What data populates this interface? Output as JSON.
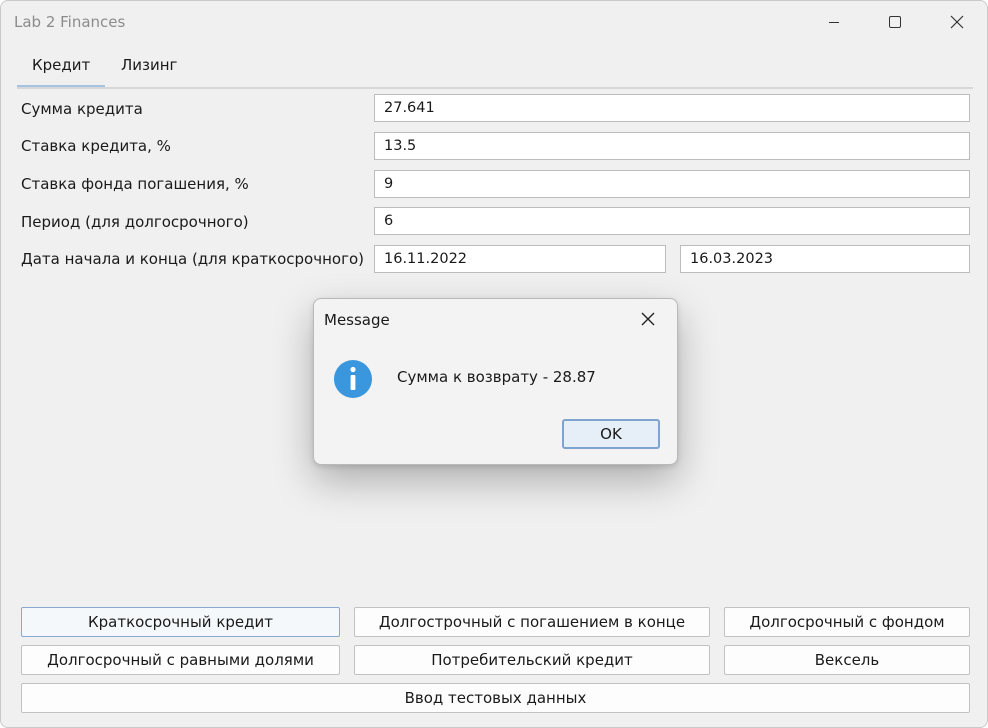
{
  "window": {
    "title": "Lab 2 Finances"
  },
  "tabs": [
    {
      "label": "Кредит",
      "active": true
    },
    {
      "label": "Лизинг",
      "active": false
    }
  ],
  "form": {
    "loan_amount": {
      "label": "Сумма кредита",
      "value": "27.641"
    },
    "loan_rate": {
      "label": "Ставка кредита, %",
      "value": "13.5"
    },
    "fund_rate": {
      "label": "Ставка фонда погашения, %",
      "value": "9"
    },
    "period": {
      "label": "Период (для долгосрочного)",
      "value": "6"
    },
    "dates": {
      "label": "Дата начала и конца (для краткосрочного)",
      "start": "16.11.2022",
      "end": "16.03.2023"
    }
  },
  "buttons": {
    "short_term": "Краткосрочный кредит",
    "long_term_end": "Долгострочный с погашением в конце",
    "long_term_fund": "Долгосрочный с фондом",
    "long_term_equal": "Долгосрочный с равными долями",
    "consumer": "Потребительский кредит",
    "bill": "Вексель",
    "test_data": "Ввод тестовых данных"
  },
  "dialog": {
    "title": "Message",
    "message": "Сумма к возврату - 28.87",
    "ok_label": "OK",
    "icon": "info-icon",
    "icon_color": "#3a96dd"
  }
}
